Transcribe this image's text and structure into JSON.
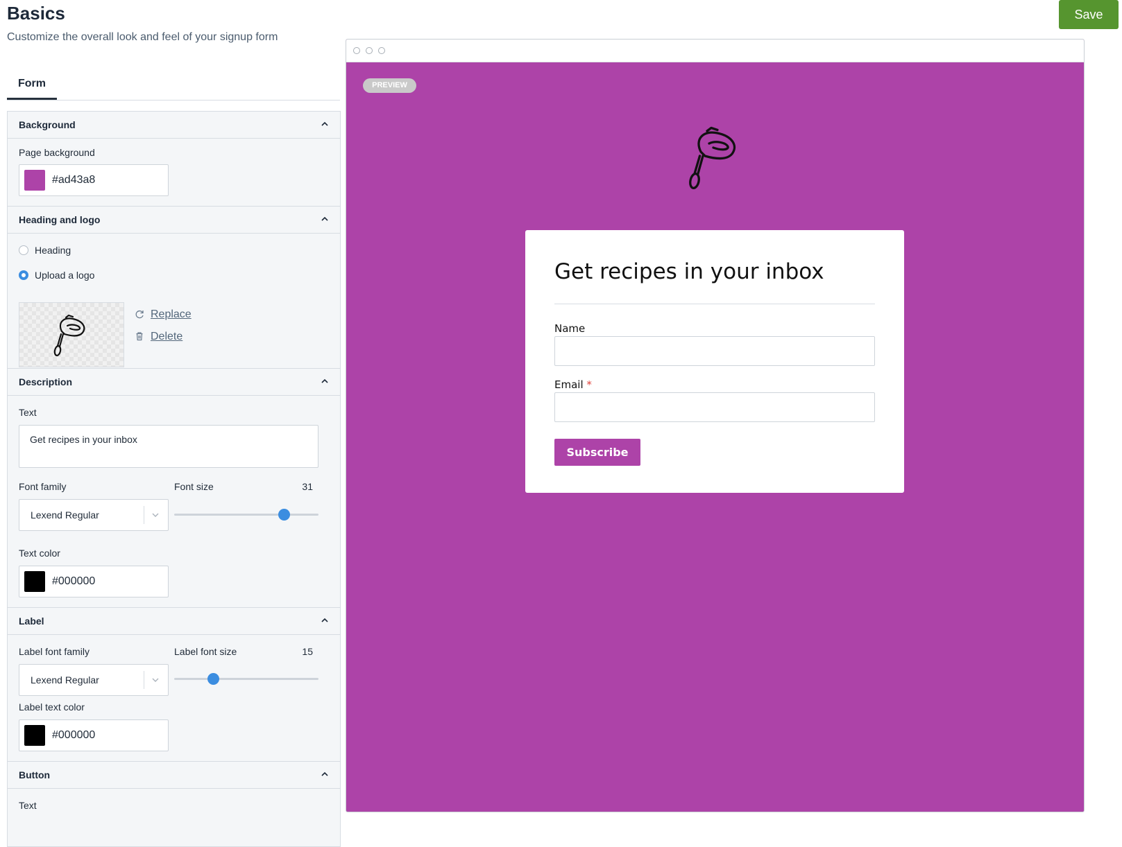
{
  "header": {
    "title": "Basics",
    "subtitle": "Customize the overall look and feel of your signup form",
    "save_label": "Save"
  },
  "tabs": [
    {
      "label": "Form"
    }
  ],
  "sections": {
    "background": {
      "title": "Background",
      "page_background_label": "Page background",
      "page_background_value": "#ad43a8"
    },
    "heading_logo": {
      "title": "Heading and logo",
      "options": [
        "Heading",
        "Upload a logo"
      ],
      "selected": "Upload a logo",
      "replace_label": "Replace",
      "delete_label": "Delete"
    },
    "description": {
      "title": "Description",
      "text_label": "Text",
      "text_value": "Get recipes in your inbox",
      "font_family_label": "Font family",
      "font_family_value": "Lexend Regular",
      "font_size_label": "Font size",
      "font_size_value": "31",
      "font_size_fraction": 0.76,
      "text_color_label": "Text color",
      "text_color_value": "#000000"
    },
    "label": {
      "title": "Label",
      "font_family_label": "Label font family",
      "font_family_value": "Lexend Regular",
      "font_size_label": "Label font size",
      "font_size_value": "15",
      "font_size_fraction": 0.27,
      "text_color_label": "Label text color",
      "text_color_value": "#000000"
    },
    "button": {
      "title": "Button",
      "text_label": "Text"
    }
  },
  "preview": {
    "badge": "PREVIEW",
    "background": "#ad43a8",
    "form": {
      "title": "Get recipes in your inbox",
      "fields": [
        {
          "label": "Name",
          "required": false
        },
        {
          "label": "Email",
          "required": true,
          "required_mark": "*"
        }
      ],
      "button_label": "Subscribe"
    }
  },
  "icons": [
    "chevron-up-icon",
    "chevron-down-icon",
    "refresh-icon",
    "trash-icon",
    "hand-mixer-logo"
  ],
  "colors": {
    "save_button": "#56952f",
    "accent_blue": "#3b8de0",
    "brand": "#ad43a8"
  }
}
